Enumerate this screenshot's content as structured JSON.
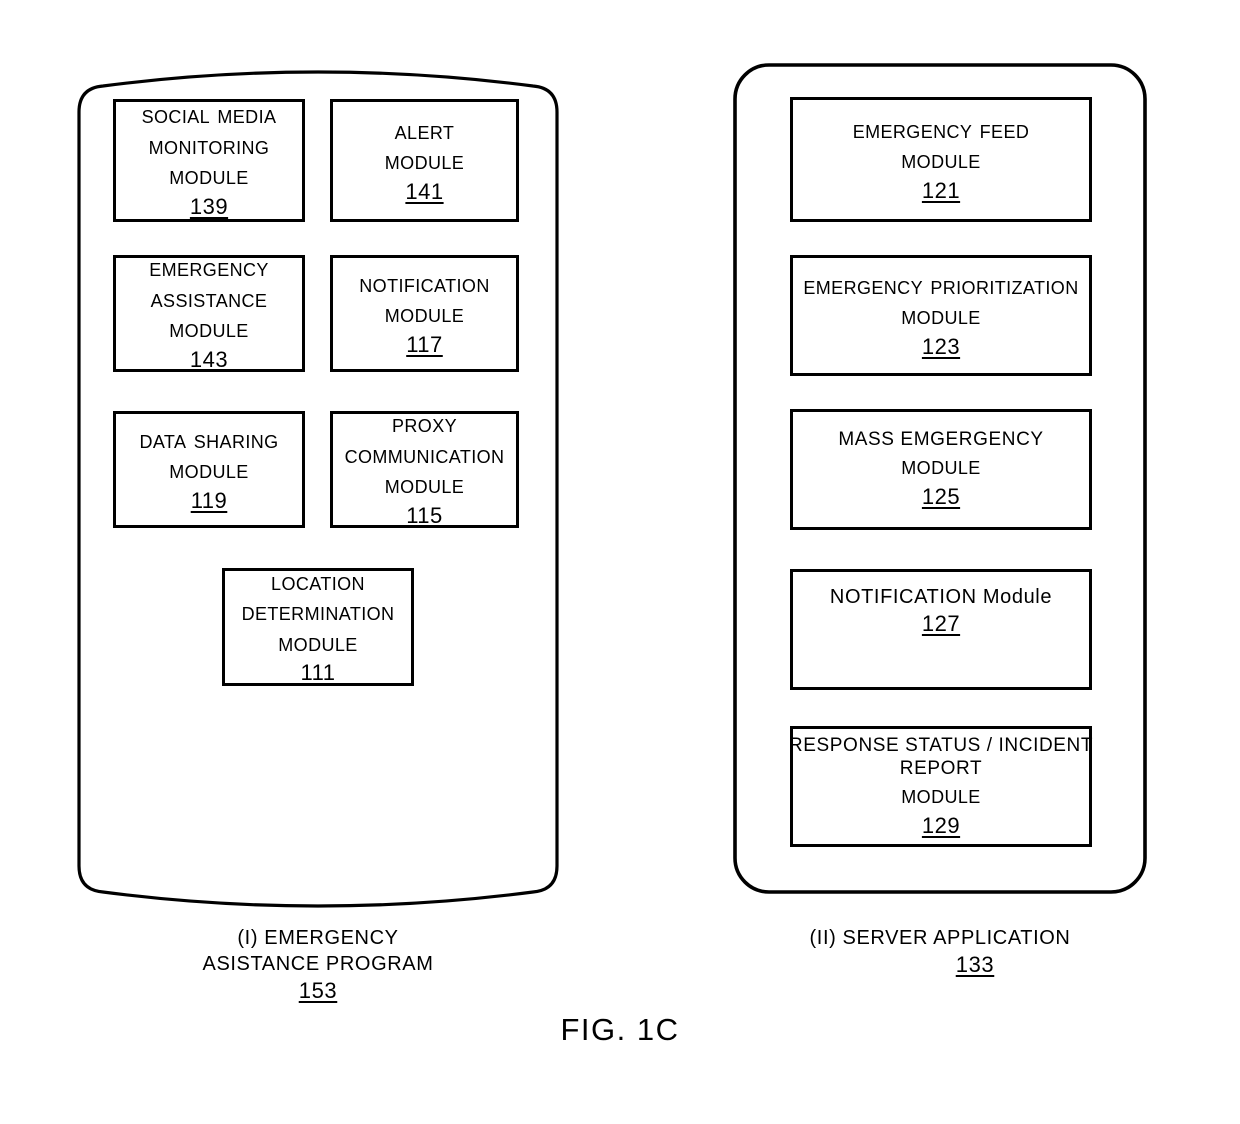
{
  "figure": {
    "label": "FIG. 1C"
  },
  "panels": [
    {
      "id": "emergency-assistance-program",
      "shape": "barrel",
      "caption": {
        "lines": [
          "(I) EMERGENCY",
          "ASISTANCE PROGRAM"
        ],
        "ref": "153"
      },
      "modules": [
        {
          "id": "social-media-monitoring-module",
          "lines": [
            "Social Media",
            "Monitoring",
            "Module"
          ],
          "style": "smallcaps",
          "ref": "139"
        },
        {
          "id": "alert-module",
          "lines": [
            "Alert",
            "Module"
          ],
          "style": "smallcaps",
          "ref": "141"
        },
        {
          "id": "emergency-assistance-module",
          "lines": [
            "Emergency",
            "Assistance",
            "Module"
          ],
          "style": "smallcaps",
          "ref": "143"
        },
        {
          "id": "notification-module",
          "lines": [
            "Notification",
            "Module"
          ],
          "style": "smallcaps",
          "ref": "117"
        },
        {
          "id": "data-sharing-module",
          "lines": [
            "Data Sharing",
            "Module"
          ],
          "style": "smallcaps",
          "ref": "119"
        },
        {
          "id": "proxy-communication-module",
          "lines": [
            "Proxy",
            "Communication",
            "Module"
          ],
          "style": "smallcaps",
          "ref": "115"
        },
        {
          "id": "location-determination-module",
          "lines": [
            "Location",
            "Determination",
            "Module"
          ],
          "style": "smallcaps",
          "ref": "111"
        }
      ]
    },
    {
      "id": "server-application",
      "shape": "rounded-rect",
      "caption": {
        "lines": [
          "(II) SERVER APPLICATION"
        ],
        "ref": "133"
      },
      "modules": [
        {
          "id": "emergency-feed-module",
          "lines": [
            "Emergency feed",
            "Module"
          ],
          "style": "smallcaps",
          "ref": "121"
        },
        {
          "id": "emergency-prioritization-module",
          "lines": [
            "Emergency prioritization",
            "Module"
          ],
          "style": "smallcaps",
          "ref": "123"
        },
        {
          "id": "mass-emergency-module",
          "lines": [
            "MASS EMGERGENCY",
            "Module"
          ],
          "style": "mixed",
          "ref": "125"
        },
        {
          "id": "server-notification-module",
          "lines": [
            "NOTIFICATION Module"
          ],
          "style": "mixed",
          "ref": "127"
        },
        {
          "id": "response-status-incident-report-module",
          "lines": [
            "RESPONSE STATUS / INCIDENT",
            "REPORT",
            "Module"
          ],
          "style": "mixed",
          "ref": "129"
        }
      ]
    }
  ],
  "colors": {
    "ink": "#000000",
    "paper": "#ffffff"
  }
}
